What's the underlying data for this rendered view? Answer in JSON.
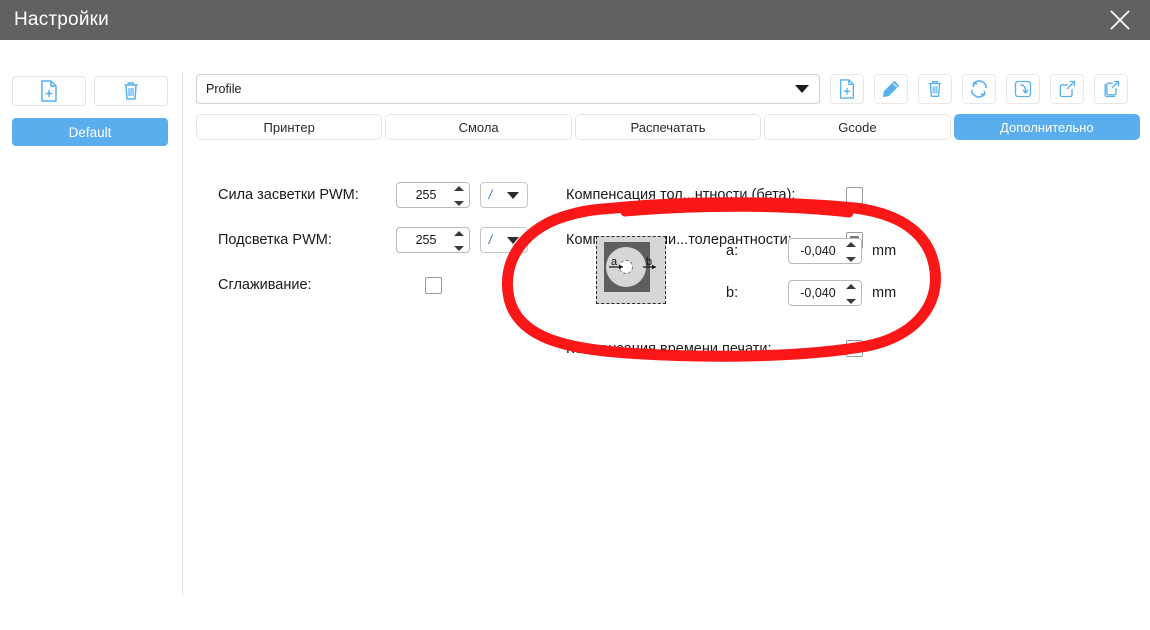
{
  "window": {
    "title": "Настройки",
    "close_icon": "close-icon"
  },
  "sidebar": {
    "buttons": [
      {
        "name": "new-profile-button",
        "icon": "new-file-icon"
      },
      {
        "name": "delete-profile-button",
        "icon": "trash-icon"
      }
    ],
    "profiles": [
      {
        "label": "Default",
        "active": true
      }
    ]
  },
  "profile_bar": {
    "combo_value": "Profile",
    "combo_arrow_icon": "chevron-down-icon",
    "tools": [
      {
        "name": "new-file-button",
        "icon": "new-file-icon"
      },
      {
        "name": "edit-button",
        "icon": "pencil-icon"
      },
      {
        "name": "delete-button",
        "icon": "trash-icon"
      },
      {
        "name": "refresh-button",
        "icon": "refresh-icon"
      },
      {
        "name": "import-button",
        "icon": "arrow-into-box-icon"
      },
      {
        "name": "export-button",
        "icon": "arrow-out-of-box-icon"
      },
      {
        "name": "duplicate-export-button",
        "icon": "copy-export-icon"
      }
    ]
  },
  "tabs": [
    {
      "label": "Принтер",
      "active": false
    },
    {
      "label": "Смола",
      "active": false
    },
    {
      "label": "Распечатать",
      "active": false
    },
    {
      "label": "Gcode",
      "active": false
    },
    {
      "label": "Дополнительно",
      "active": true
    }
  ],
  "advanced": {
    "left": {
      "light_power": {
        "label": "Сила засветки PWM:",
        "value": "255",
        "unit": "/"
      },
      "backlight": {
        "label": "Подсветка PWM:",
        "value": "255",
        "unit": "/"
      },
      "antialias": {
        "label": "Сглаживание:",
        "checked": false
      }
    },
    "right": {
      "thickness_comp": {
        "label": "Компенсация тол...нтности (бета):",
        "checked": false
      },
      "tolerance_comp": {
        "label": "Компенсация ни...толерантности:",
        "checked": true,
        "diagram": {
          "name": "tolerance-diagram",
          "label_a": "a",
          "label_b": "b"
        },
        "a": {
          "label": "a:",
          "value": "-0,040",
          "unit": "mm"
        },
        "b": {
          "label": "b:",
          "value": "-0,040",
          "unit": "mm"
        }
      },
      "print_time_comp": {
        "label": "Компенсация времени печати:",
        "checked": false
      }
    }
  },
  "annotation": {
    "type": "hand-drawn-red-oval",
    "color": "#fb1717",
    "target": "Компенсация ни...толерантности"
  },
  "colors": {
    "titlebar": "#616161",
    "accent": "#5aaeee",
    "icon_blue": "#57b0ef",
    "annotation_red": "#fb1717"
  }
}
